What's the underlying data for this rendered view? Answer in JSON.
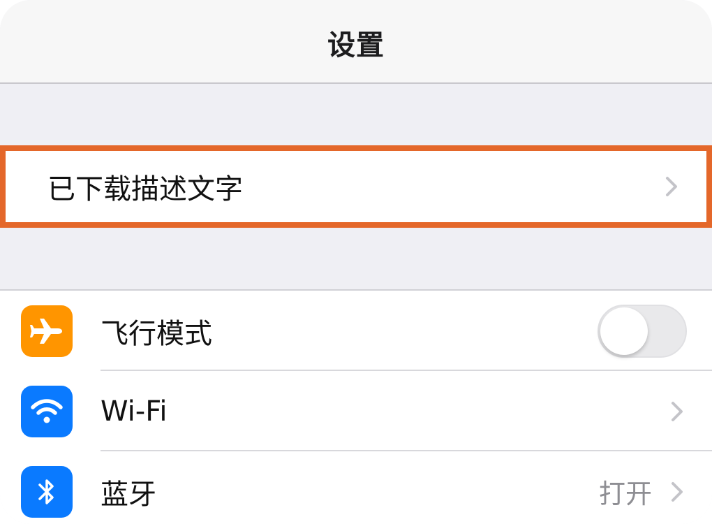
{
  "navbar": {
    "title": "设置"
  },
  "profile_row": {
    "label": "已下载描述文字"
  },
  "settings": [
    {
      "key": "airplane",
      "label": "飞行模式",
      "icon": "airplane-icon",
      "icon_color": "#ff9500",
      "control": "toggle",
      "toggle_on": false
    },
    {
      "key": "wifi",
      "label": "Wi-Fi",
      "icon": "wifi-icon",
      "icon_color": "#0a7aff",
      "control": "chevron"
    },
    {
      "key": "bluetooth",
      "label": "蓝牙",
      "icon": "bluetooth-icon",
      "icon_color": "#0a7aff",
      "control": "chevron",
      "value": "打开"
    }
  ],
  "colors": {
    "highlight_border": "#e4672a",
    "background": "#efeff4"
  }
}
